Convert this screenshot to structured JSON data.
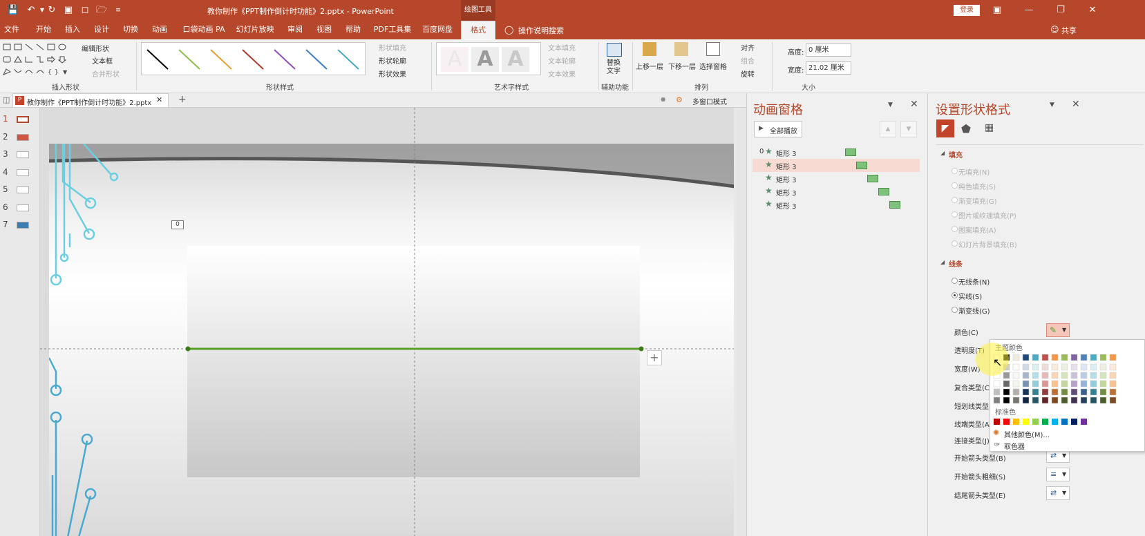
{
  "titlebar": {
    "title": "教你制作《PPT制作倒计时功能》2.pptx  -  PowerPoint",
    "context_tab": "绘图工具",
    "login": "登录"
  },
  "tabs": [
    "文件",
    "开始",
    "插入",
    "设计",
    "切换",
    "动画",
    "口袋动画 PA",
    "幻灯片放映",
    "审阅",
    "视图",
    "帮助",
    "PDF工具集",
    "百度网盘",
    "格式"
  ],
  "tell_me": "操作说明搜索",
  "share": "共享",
  "ribbon": {
    "insert_shapes": {
      "label": "插入形状",
      "edit_shape": "编辑形状",
      "text_box": "文本框",
      "merge_shapes": "合并形状"
    },
    "shape_styles": {
      "label": "形状样式",
      "fill": "形状填充",
      "outline": "形状轮廓",
      "effects": "形状效果"
    },
    "wordart": {
      "label": "艺术字样式",
      "text_fill": "文本填充",
      "text_outline": "文本轮廓",
      "text_effects": "文本效果",
      "sample": "A"
    },
    "accessibility": {
      "label": "辅助功能",
      "alt_text": "替换\n文字"
    },
    "arrange": {
      "label": "排列",
      "bring_forward": "上移一层",
      "send_backward": "下移一层",
      "selection_pane": "选择窗格",
      "align": "对齐",
      "group": "组合",
      "rotate": "旋转"
    },
    "size": {
      "label": "大小",
      "height_label": "高度:",
      "height_value": "0 厘米",
      "width_label": "宽度:",
      "width_value": "21.02 厘米"
    }
  },
  "doc_tab": {
    "name": "教你制作《PPT制作倒计时功能》2.pptx",
    "multi_window": "多窗口模式"
  },
  "slides": [
    "1",
    "2",
    "3",
    "4",
    "5",
    "6",
    "7"
  ],
  "canvas": {
    "anim_tag": "0"
  },
  "animation_pane": {
    "title": "动画窗格",
    "play_all": "全部播放",
    "items": [
      {
        "index": "0",
        "name": "矩形 3"
      },
      {
        "index": "",
        "name": "矩形 3"
      },
      {
        "index": "",
        "name": "矩形 3"
      },
      {
        "index": "",
        "name": "矩形 3"
      },
      {
        "index": "",
        "name": "矩形 3"
      }
    ]
  },
  "format_pane": {
    "title": "设置形状格式",
    "fill_section": "填充",
    "fill_options": [
      "无填充(N)",
      "纯色填充(S)",
      "渐变填充(G)",
      "图片或纹理填充(P)",
      "图案填充(A)",
      "幻灯片背景填充(B)"
    ],
    "line_section": "线条",
    "line_options": [
      "无线条(N)",
      "实线(S)",
      "渐变线(G)"
    ],
    "props": [
      "颜色(C)",
      "透明度(T)",
      "宽度(W)",
      "复合类型(C)",
      "短划线类型(D)",
      "线端类型(A)",
      "连接类型(J)",
      "开始箭头类型(B)",
      "开始箭头粗细(S)",
      "结尾箭头类型(E)"
    ]
  },
  "color_popup": {
    "theme_label": "主题颜色",
    "standard_label": "标准色",
    "more_colors": "其他颜色(M)...",
    "eyedropper": "取色器",
    "theme_top": [
      "#ffffff",
      "#000000",
      "#eeece1",
      "#1f497d",
      "#4bacc6",
      "#c0504d",
      "#f79646",
      "#9bbb59",
      "#8064a2",
      "#4f81bd",
      "#4bacc6",
      "#9bbb59",
      "#f79646"
    ],
    "standard": [
      "#c00000",
      "#ff0000",
      "#ffc000",
      "#ffff00",
      "#92d050",
      "#00b050",
      "#00b0f0",
      "#0070c0",
      "#002060",
      "#7030a0"
    ]
  },
  "colors": {
    "accent": "#b7472a",
    "line_green": "#5a9e2a",
    "circuit": "#6ccfe0"
  }
}
